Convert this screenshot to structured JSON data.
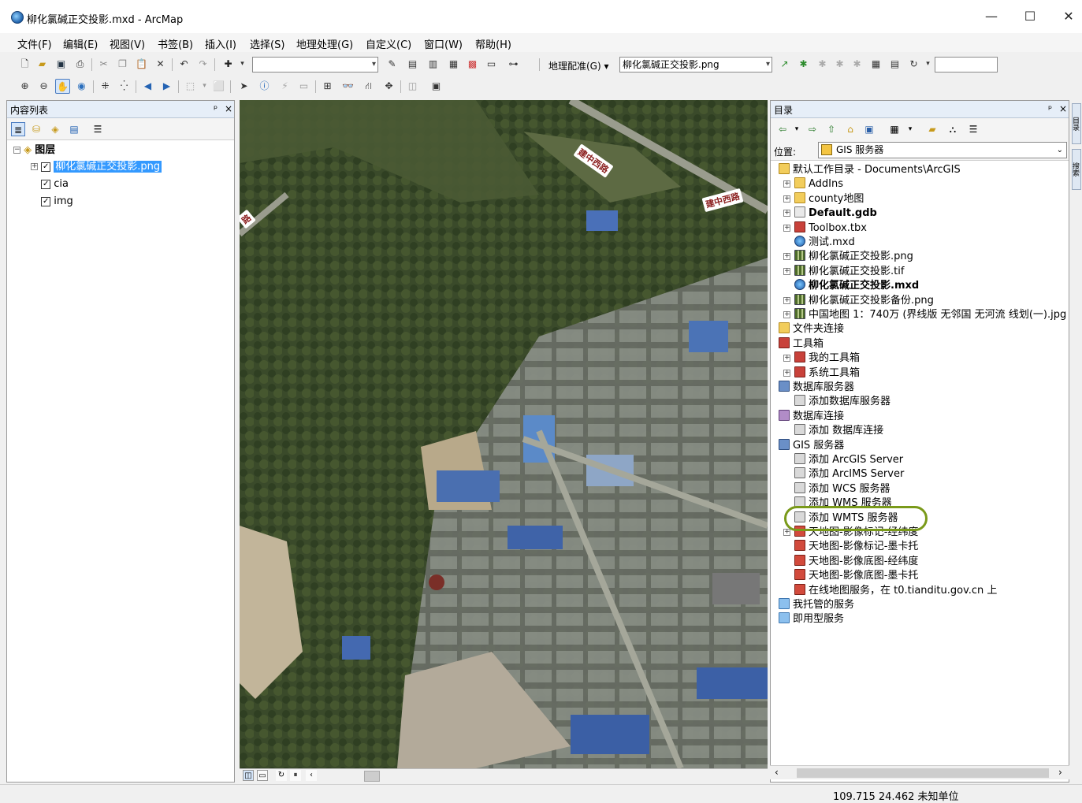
{
  "window": {
    "title": "柳化氯碱正交投影.mxd - ArcMap",
    "minimize": "—",
    "maximize": "☐",
    "close": "✕"
  },
  "menu": [
    "文件(F)",
    "编辑(E)",
    "视图(V)",
    "书签(B)",
    "插入(I)",
    "选择(S)",
    "地理处理(G)",
    "自定义(C)",
    "窗口(W)",
    "帮助(H)"
  ],
  "toolbar": {
    "scale_value": "",
    "georef_label": "地理配准(G) ▾",
    "georef_layer": "柳化氯碱正交投影.png",
    "georef_input": ""
  },
  "toc": {
    "title": "内容列表",
    "pin": "ᵖ",
    "close": "×",
    "layers_root": "图层",
    "layers": [
      {
        "name": "柳化氯碱正交投影.png",
        "checked": "✓",
        "selected": true
      },
      {
        "name": "cia",
        "checked": "✓"
      },
      {
        "name": "img",
        "checked": "✓"
      }
    ]
  },
  "map": {
    "road_labels": [
      "建中西路",
      "建中西路",
      "路"
    ]
  },
  "catalog": {
    "title": "目录",
    "location_label": "位置:",
    "location_value": "GIS 服务器",
    "items": [
      {
        "label": "默认工作目录 - Documents\\ArcGIS",
        "icon": "folder-home-icon",
        "indent": 0,
        "expander": ""
      },
      {
        "label": "AddIns",
        "icon": "folder-icon",
        "indent": 1,
        "expander": "+"
      },
      {
        "label": "county地图",
        "icon": "folder-icon",
        "indent": 1,
        "expander": "+"
      },
      {
        "label": "Default.gdb",
        "icon": "geodatabase-icon",
        "indent": 1,
        "expander": "+",
        "bold": true
      },
      {
        "label": "Toolbox.tbx",
        "icon": "toolbox-icon",
        "indent": 1,
        "expander": "+"
      },
      {
        "label": "测试.mxd",
        "icon": "mxd-icon",
        "indent": 1,
        "expander": ""
      },
      {
        "label": "柳化氯碱正交投影.png",
        "icon": "raster-icon",
        "indent": 1,
        "expander": "+"
      },
      {
        "label": "柳化氯碱正交投影.tif",
        "icon": "raster-icon",
        "indent": 1,
        "expander": "+"
      },
      {
        "label": "柳化氯碱正交投影.mxd",
        "icon": "mxd-icon",
        "indent": 1,
        "expander": "",
        "bold": true
      },
      {
        "label": "柳化氯碱正交投影备份.png",
        "icon": "raster-icon",
        "indent": 1,
        "expander": "+"
      },
      {
        "label": "中国地图 1：740万 (界线版 无邻国 无河流 线划(一).jpg",
        "icon": "raster-icon",
        "indent": 1,
        "expander": "+"
      },
      {
        "label": "文件夹连接",
        "icon": "folder-connection-icon",
        "indent": 0,
        "expander": ""
      },
      {
        "label": "工具箱",
        "icon": "toolbox-icon",
        "indent": 0,
        "expander": ""
      },
      {
        "label": "我的工具箱",
        "icon": "toolbox-icon",
        "indent": 1,
        "expander": "+"
      },
      {
        "label": "系统工具箱",
        "icon": "toolbox-icon",
        "indent": 1,
        "expander": "+"
      },
      {
        "label": "数据库服务器",
        "icon": "database-server-icon",
        "indent": 0,
        "expander": ""
      },
      {
        "label": "添加数据库服务器",
        "icon": "add-database-server-icon",
        "indent": 1,
        "expander": ""
      },
      {
        "label": "数据库连接",
        "icon": "database-connection-icon",
        "indent": 0,
        "expander": ""
      },
      {
        "label": "添加 数据库连接",
        "icon": "add-database-connection-icon",
        "indent": 1,
        "expander": ""
      },
      {
        "label": "GIS 服务器",
        "icon": "gis-server-icon",
        "indent": 0,
        "expander": ""
      },
      {
        "label": "添加 ArcGIS Server",
        "icon": "add-server-icon",
        "indent": 1,
        "expander": ""
      },
      {
        "label": "添加 ArcIMS Server",
        "icon": "add-server-icon",
        "indent": 1,
        "expander": ""
      },
      {
        "label": "添加 WCS 服务器",
        "icon": "add-server-icon",
        "indent": 1,
        "expander": ""
      },
      {
        "label": "添加 WMS 服务器",
        "icon": "add-server-icon",
        "indent": 1,
        "expander": ""
      },
      {
        "label": "添加 WMTS 服务器",
        "icon": "add-server-icon",
        "indent": 1,
        "expander": ""
      },
      {
        "label": "天地图-影像标记-经纬度",
        "icon": "wmts-service-icon",
        "indent": 1,
        "expander": "+"
      },
      {
        "label": "天地图-影像标记-墨卡托",
        "icon": "wmts-service-icon",
        "indent": 1,
        "expander": ""
      },
      {
        "label": "天地图-影像底图-经纬度",
        "icon": "wmts-service-icon",
        "indent": 1,
        "expander": ""
      },
      {
        "label": "天地图-影像底图-墨卡托",
        "icon": "wmts-service-icon",
        "indent": 1,
        "expander": ""
      },
      {
        "label": "在线地图服务，在 t0.tianditu.gov.cn 上",
        "icon": "wmts-service-icon",
        "indent": 1,
        "expander": ""
      },
      {
        "label": "我托管的服务",
        "icon": "hosted-services-icon",
        "indent": 0,
        "expander": ""
      },
      {
        "label": "即用型服务",
        "icon": "ready-services-icon",
        "indent": 0,
        "expander": ""
      }
    ]
  },
  "side_tabs": [
    "目录",
    "搜索"
  ],
  "status": {
    "coords": "109.715  24.462 未知单位"
  }
}
